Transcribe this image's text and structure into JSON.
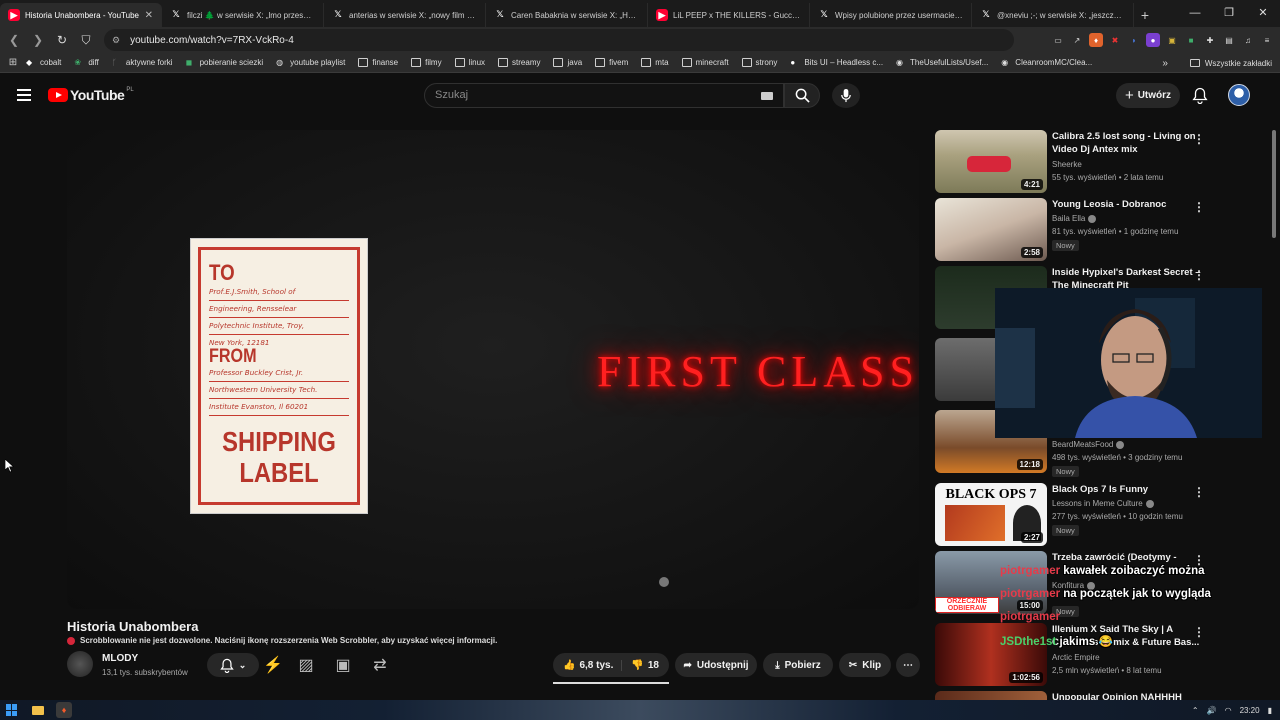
{
  "browser": {
    "tabs": [
      {
        "title": "Historia Unabombera - YouTube",
        "icon": "youtube-icon",
        "active": true
      },
      {
        "title": "filczi 🌲 w serwisie X: „lmo przesada",
        "icon": "x-icon"
      },
      {
        "title": "anterias w serwisie X: „nowy film doc",
        "icon": "x-icon"
      },
      {
        "title": "Caren Babaknia w serwisie X: „How c",
        "icon": "x-icon"
      },
      {
        "title": "LiL PEEP x THE KILLERS - Gucci Mane",
        "icon": "youtube-icon"
      },
      {
        "title": "Wpisy polubione przez usermacieg (",
        "icon": "x-icon"
      },
      {
        "title": "@xneviu ;-; w serwisie X: „jeszcze fik",
        "icon": "x-icon"
      }
    ],
    "url": "youtube.com/watch?v=7RX-VckRo-4",
    "bookmarks": [
      {
        "label": "cobalt",
        "icon": "cobalt-icon"
      },
      {
        "label": "diff",
        "icon": "diff-icon"
      },
      {
        "label": "aktywne forki",
        "icon": "fork-icon"
      },
      {
        "label": "pobieranie sciezki",
        "icon": "download-icon"
      },
      {
        "label": "youtube playlist",
        "icon": "globe-icon"
      },
      {
        "label": "finanse",
        "icon": "folder-icon"
      },
      {
        "label": "filmy",
        "icon": "folder-icon"
      },
      {
        "label": "linux",
        "icon": "folder-icon"
      },
      {
        "label": "streamy",
        "icon": "folder-icon"
      },
      {
        "label": "java",
        "icon": "folder-icon"
      },
      {
        "label": "fivem",
        "icon": "folder-icon"
      },
      {
        "label": "mta",
        "icon": "folder-icon"
      },
      {
        "label": "minecraft",
        "icon": "folder-icon"
      },
      {
        "label": "strony",
        "icon": "folder-icon"
      },
      {
        "label": "Bits UI – Headless c...",
        "icon": "circle-icon"
      },
      {
        "label": "TheUsefulLists/Usef...",
        "icon": "github-icon"
      },
      {
        "label": "CleanroomMC/Clea...",
        "icon": "github-icon"
      }
    ],
    "bookmarks_overflow": "»",
    "all_bookmarks": "Wszystkie zakładki"
  },
  "youtube": {
    "logo_text": "YouTube",
    "logo_country": "PL",
    "search_placeholder": "Szukaj",
    "create_label": "Utwórz"
  },
  "video": {
    "label_to": "TO",
    "label_to_lines": [
      "Prof.E.J.Smith, School of",
      "Engineering, Rensselear",
      "Polytechnic Institute, Troy,",
      "New York, 12181"
    ],
    "label_from": "FROM",
    "label_from_lines": [
      "Professor Buckley Crist, Jr.",
      "Northwestern University Tech.",
      "Institute Evanston, Il 60201"
    ],
    "label_shipping": "SHIPPING",
    "label_label": "LABEL",
    "neon_text": "FIRST CLASS",
    "title": "Historia Unabombera",
    "scrobbler_notice": "Scrobblowanie nie jest dozwolone. Naciśnij ikonę rozszerzenia Web Scrobbler, aby uzyskać więcej informacji.",
    "channel": "MLODY",
    "subscribers": "13,1 tys. subskrybentów",
    "likes": "6,8 tys.",
    "dislikes": "18",
    "share_label": "Udostępnij",
    "download_label": "Pobierz",
    "clip_label": "Klip"
  },
  "recommendations": [
    {
      "title": "Calibra 2.5 lost song - Living on Video Dj Antex mix",
      "channel": "Sheerke",
      "meta": "55 tys. wyświetleń • 2 lata temu",
      "duration": "4:21",
      "badge": ""
    },
    {
      "title": "Young Leosia - Dobranoc",
      "channel": "Baila Ella",
      "meta": "81 tys. wyświetleń • 1 godzinę temu",
      "duration": "2:58",
      "badge": "Nowy"
    },
    {
      "title": "Inside Hypixel's Darkest Secret – The Minecraft Pit",
      "channel": "",
      "meta": "",
      "duration": "",
      "badge": ""
    },
    {
      "title": "",
      "channel": "",
      "meta": "",
      "duration": "",
      "badge": ""
    },
    {
      "title": "",
      "channel": "BeardMeatsFood",
      "meta": "498 tys. wyświetleń • 3 godziny temu",
      "duration": "12:18",
      "badge": "Nowy"
    },
    {
      "title": "Black Ops 7 Is Funny",
      "channel": "Lessons in Meme Culture",
      "meta": "277 tys. wyświetleń • 10 godzin temu",
      "duration": "2:27",
      "badge": "Nowy",
      "thumb_text": "BLACK OPS 7"
    },
    {
      "title": "Trzeba zawrócić (Deotymy -",
      "channel": "Konfitura",
      "meta": "",
      "duration": "15:00",
      "badge": "Nowy",
      "thumb_text": "ORZECZNIE ODBIERAW"
    },
    {
      "title": "Illenium X Said The Sky | A Christmas Remix & Future Bas...",
      "channel": "Arctic Empire",
      "meta": "2,5 mln wyświetleń • 8 lat temu",
      "duration": "1:02:56",
      "badge": ""
    },
    {
      "title": "Unpopular Opinion NAHHHH",
      "channel": "",
      "meta": "",
      "duration": "",
      "badge": ""
    }
  ],
  "chat": [
    {
      "user": "piotrgamer",
      "message": "kawałek zoibaczyć można"
    },
    {
      "user": "piotrgamer",
      "message": "na początek jak to wygląda"
    },
    {
      "user": "piotrgamer",
      "message": ""
    },
    {
      "user": "JSDthe1st",
      "message": "jakims 😂"
    }
  ],
  "taskbar": {
    "time": "23:20"
  },
  "colors": {
    "youtube_red": "#ff0000",
    "neon_red": "#ff2020",
    "label_red": "#c63a2f",
    "chat_name": "#e63b4a"
  }
}
